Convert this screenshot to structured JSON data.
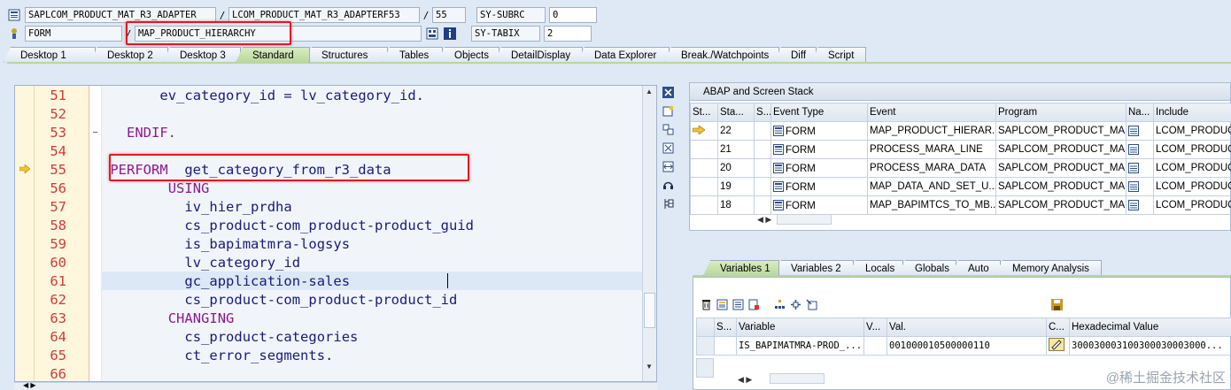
{
  "header": {
    "program": "SAPLCOM_PRODUCT_MAT_R3_ADAPTER",
    "include": "LCOM_PRODUCT_MAT_R3_ADAPTERF53",
    "line": "55",
    "subrc_label": "SY-SUBRC",
    "subrc_value": "0",
    "event_type": "FORM",
    "event": "MAP_PRODUCT_HIERARCHY",
    "tabix_label": "SY-TABIX",
    "tabix_value": "2",
    "slash": "/"
  },
  "tabs": [
    {
      "label": "Desktop 1"
    },
    {
      "label": "Desktop 2"
    },
    {
      "label": "Desktop 3"
    },
    {
      "label": "Standard"
    },
    {
      "label": "Structures"
    },
    {
      "label": "Tables"
    },
    {
      "label": "Objects"
    },
    {
      "label": "DetailDisplay"
    },
    {
      "label": "Data Explorer"
    },
    {
      "label": "Break./Watchpoints"
    },
    {
      "label": "Diff"
    },
    {
      "label": "Script"
    }
  ],
  "editor": {
    "lines": [
      {
        "num": "51",
        "code": "ev_category_id = lv_category_id.",
        "indent": 7
      },
      {
        "num": "52",
        "code": "",
        "indent": 0
      },
      {
        "num": "53",
        "code": "ENDIF.",
        "indent": 3,
        "kw": true
      },
      {
        "num": "54",
        "code": "",
        "indent": 0
      },
      {
        "num": "55",
        "kwpart": "PERFORM",
        "code": "  get_category_from_r3_data",
        "indent": 1
      },
      {
        "num": "56",
        "code": "USING",
        "indent": 8,
        "kw": true
      },
      {
        "num": "57",
        "code": "iv_hier_prdha",
        "indent": 10
      },
      {
        "num": "58",
        "code": "cs_product-com_product-product_guid",
        "indent": 10
      },
      {
        "num": "59",
        "code": "is_bapimatmra-logsys",
        "indent": 10
      },
      {
        "num": "60",
        "code": "lv_category_id",
        "indent": 10
      },
      {
        "num": "61",
        "code": "gc_application-sales",
        "indent": 10
      },
      {
        "num": "62",
        "code": "cs_product-com_product-product_id",
        "indent": 10
      },
      {
        "num": "63",
        "code": "CHANGING",
        "indent": 8,
        "kw": true
      },
      {
        "num": "64",
        "code": "cs_product-categories",
        "indent": 10
      },
      {
        "num": "65",
        "code": "ct_error_segments.",
        "indent": 10
      },
      {
        "num": "66",
        "code": "",
        "indent": 0
      }
    ]
  },
  "stack": {
    "title": "ABAP and Screen Stack",
    "columns": [
      "St...",
      "Sta...",
      "S...",
      "Event Type",
      "Event",
      "Program",
      "Na...",
      "Include"
    ],
    "rows": [
      {
        "level": "22",
        "type": "FORM",
        "event": "MAP_PRODUCT_HIERAR...",
        "program": "SAPLCOM_PRODUCT_MA...",
        "include": "LCOM_PRODUCT",
        "current": true
      },
      {
        "level": "21",
        "type": "FORM",
        "event": "PROCESS_MARA_LINE",
        "program": "SAPLCOM_PRODUCT_MA...",
        "include": "LCOM_PRODUCT"
      },
      {
        "level": "20",
        "type": "FORM",
        "event": "PROCESS_MARA_DATA",
        "program": "SAPLCOM_PRODUCT_MA...",
        "include": "LCOM_PRODUCT"
      },
      {
        "level": "19",
        "type": "FORM",
        "event": "MAP_DATA_AND_SET_U...",
        "program": "SAPLCOM_PRODUCT_MA...",
        "include": "LCOM_PRODUCT"
      },
      {
        "level": "18",
        "type": "FORM",
        "event": "MAP_BAPIMTCS_TO_MB...",
        "program": "SAPLCOM_PRODUCT_MA...",
        "include": "LCOM_PRODUCT"
      }
    ]
  },
  "var_tabs": [
    {
      "label": "Variables 1"
    },
    {
      "label": "Variables 2"
    },
    {
      "label": "Locals"
    },
    {
      "label": "Globals"
    },
    {
      "label": "Auto"
    },
    {
      "label": "Memory Analysis"
    }
  ],
  "variables": {
    "columns": [
      "S...",
      "Variable",
      "V...",
      "Val.",
      "C...",
      "Hexadecimal Value"
    ],
    "rows": [
      {
        "variable": "IS_BAPIMATMRA-PROD_...",
        "value": "001000010500000110",
        "hex": "300030003100300030003000..."
      }
    ]
  },
  "watermark": "@稀土掘金技术社区",
  "colors": {
    "highlight": "#e0191e",
    "keyword": "#8c1a8c",
    "code": "#1a1a7a",
    "linenum": "#d03a3a",
    "active_tab": "#b8d79b"
  }
}
